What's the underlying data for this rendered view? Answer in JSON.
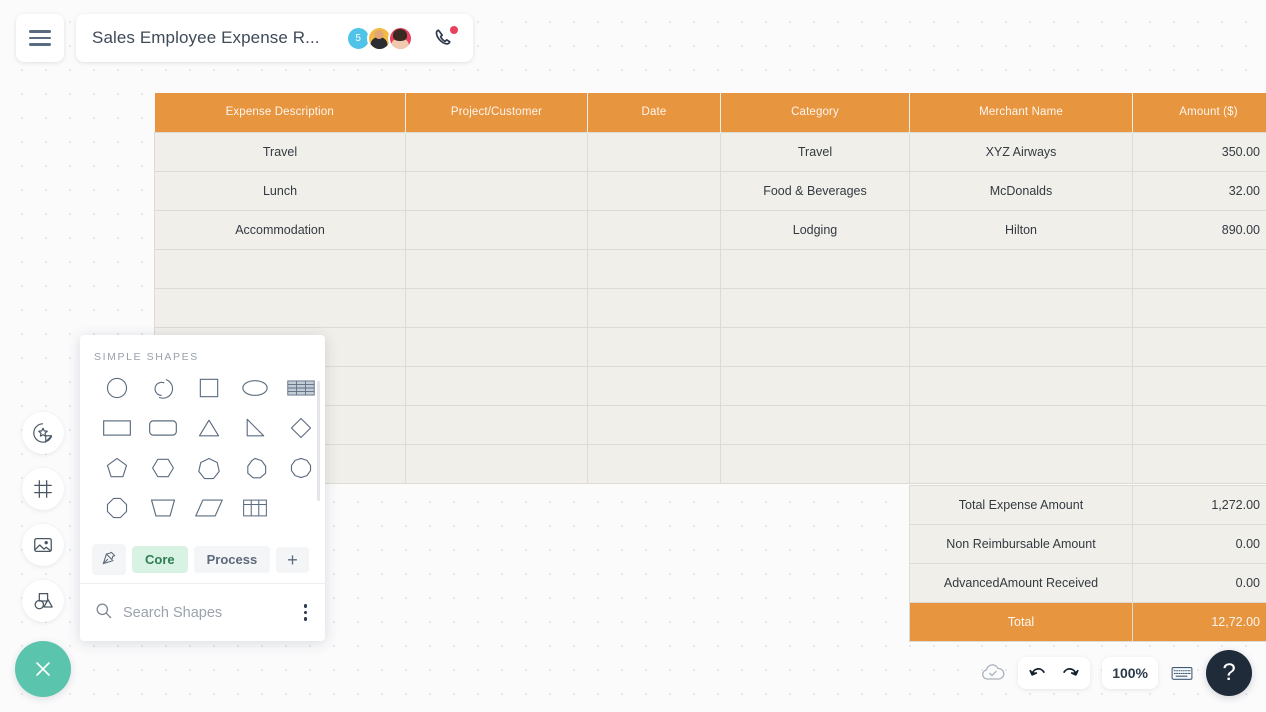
{
  "header": {
    "menu_icon": "hamburger-icon",
    "document_title": "Sales Employee Expense R...",
    "collaborator_count": "5",
    "phone_icon": "phone-call-icon"
  },
  "rail": {
    "items": [
      {
        "icon": "sticker-star-icon",
        "name": "stickers-tool"
      },
      {
        "icon": "frame-icon",
        "name": "frame-tool"
      },
      {
        "icon": "image-icon",
        "name": "image-tool"
      },
      {
        "icon": "shapes-icon",
        "name": "shapes-tool"
      }
    ]
  },
  "table": {
    "columns": [
      "Expense Description",
      "Project/Customer",
      "Date",
      "Category",
      "Merchant Name",
      "Amount ($)"
    ],
    "rows": [
      {
        "description": "Travel",
        "project": "",
        "date": "",
        "category": "Travel",
        "merchant": "XYZ Airways",
        "amount": "350.00"
      },
      {
        "description": "Lunch",
        "project": "",
        "date": "",
        "category": "Food & Beverages",
        "merchant": "McDonalds",
        "amount": "32.00"
      },
      {
        "description": "Accommodation",
        "project": "",
        "date": "",
        "category": "Lodging",
        "merchant": "Hilton",
        "amount": "890.00"
      },
      {
        "description": "",
        "project": "",
        "date": "",
        "category": "",
        "merchant": "",
        "amount": ""
      },
      {
        "description": "",
        "project": "",
        "date": "",
        "category": "",
        "merchant": "",
        "amount": ""
      },
      {
        "description": "",
        "project": "",
        "date": "",
        "category": "",
        "merchant": "",
        "amount": ""
      },
      {
        "description": "",
        "project": "",
        "date": "",
        "category": "",
        "merchant": "",
        "amount": ""
      },
      {
        "description": "",
        "project": "",
        "date": "",
        "category": "",
        "merchant": "",
        "amount": ""
      },
      {
        "description": "",
        "project": "",
        "date": "",
        "category": "",
        "merchant": "",
        "amount": ""
      }
    ]
  },
  "summary": {
    "rows": [
      {
        "label": "Total Expense  Amount",
        "value": "1,272.00"
      },
      {
        "label": "Non Reimbursable Amount",
        "value": "0.00"
      },
      {
        "label": "AdvancedAmount Received",
        "value": "0.00"
      }
    ],
    "total_label": "Total",
    "total_value": "12,72.00"
  },
  "shapes_panel": {
    "heading": "SIMPLE SHAPES",
    "shapes": [
      "circle",
      "arc",
      "square",
      "ellipse",
      "table-striped",
      "rectangle",
      "rounded-rectangle",
      "triangle",
      "right-triangle",
      "diamond",
      "pentagon",
      "hexagon",
      "heptagon",
      "nonagon",
      "decagon",
      "octagon",
      "trapezoid",
      "parallelogram",
      "table-grid"
    ],
    "tabs": [
      {
        "label": "",
        "icon": "pin-icon",
        "active": false
      },
      {
        "label": "Core",
        "active": true
      },
      {
        "label": "Process",
        "active": false
      },
      {
        "label": "+",
        "active": false
      }
    ],
    "search_placeholder": "Search Shapes",
    "more_icon": "kebab-menu-icon"
  },
  "bottom_bar": {
    "cloud_status_icon": "cloud-saved-icon",
    "undo_icon": "undo-icon",
    "redo_icon": "redo-icon",
    "zoom_level": "100%",
    "keyboard_icon": "keyboard-icon",
    "help_label": "?"
  },
  "close_fab": {
    "icon": "close-icon"
  },
  "colors": {
    "accent_orange": "#e89540",
    "cell_bg": "#f1efea",
    "teal": "#5bc4ad",
    "dark": "#1f2b38",
    "tab_active": "#d8f2e4"
  }
}
